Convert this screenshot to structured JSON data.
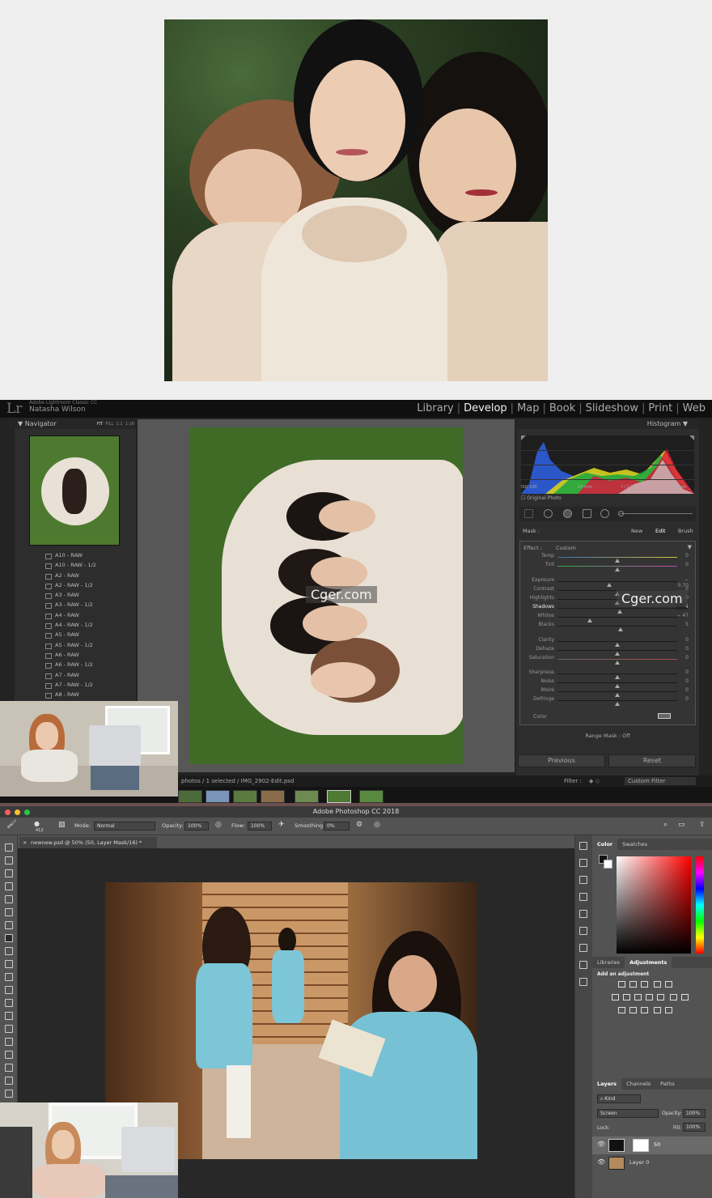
{
  "lightroom": {
    "app_name": "Adobe Lightroom Classic CC",
    "user": "Natasha Wilson",
    "modules": [
      "Library",
      "Develop",
      "Map",
      "Book",
      "Slideshow",
      "Print",
      "Web"
    ],
    "active_module": "Develop",
    "navigator": {
      "title": "Navigator",
      "zoom": [
        "FIT",
        "FILL",
        "1:1",
        "1:16"
      ]
    },
    "folders": [
      "A10 - RAW",
      "A10 - RAW - 1/2",
      "A2 - RAW",
      "A2 - RAW - 1/2",
      "A3 - RAW",
      "A3 - RAW - 1/2",
      "A4 - RAW",
      "A4 - RAW - 1/2",
      "A5 - RAW",
      "A5 - RAW - 1/2",
      "A6 - RAW",
      "A6 - RAW - 1/2",
      "A7 - RAW",
      "A7 - RAW - 1/2",
      "A8 - RAW"
    ],
    "histogram": {
      "title": "Histogram",
      "iso": "ISO 100",
      "focal": "24 mm",
      "aperture": "f / 2.8",
      "shutter": "1/320 sec",
      "original_photo": "Original Photo"
    },
    "mask": {
      "label": "Mask :",
      "options": [
        "New",
        "Edit",
        "Brush"
      ],
      "active": "Edit"
    },
    "effect": {
      "label": "Effect :",
      "preset": "Custom",
      "sliders": [
        {
          "label": "Temp",
          "value": "0",
          "pos": 0.5
        },
        {
          "label": "Tint",
          "value": "0",
          "pos": 0.5
        },
        {
          "label": "Exposure",
          "value": "− 0.70",
          "pos": 0.43
        },
        {
          "label": "Contrast",
          "value": "0",
          "pos": 0.5
        },
        {
          "label": "Highlights",
          "value": "0",
          "pos": 0.5
        },
        {
          "label": "Shadows",
          "value": "4",
          "pos": 0.52
        },
        {
          "label": "Whites",
          "value": "− 47",
          "pos": 0.27
        },
        {
          "label": "Blacks",
          "value": "5",
          "pos": 0.53
        },
        {
          "label": "Clarity",
          "value": "0",
          "pos": 0.5
        },
        {
          "label": "Dehaze",
          "value": "0",
          "pos": 0.5
        },
        {
          "label": "Saturation",
          "value": "0",
          "pos": 0.5
        },
        {
          "label": "Sharpness",
          "value": "0",
          "pos": 0.5
        },
        {
          "label": "Noise",
          "value": "0",
          "pos": 0.5
        },
        {
          "label": "Moiré",
          "value": "0",
          "pos": 0.5
        },
        {
          "label": "Defringe",
          "value": "0",
          "pos": 0.5
        }
      ],
      "color_label": "Color"
    },
    "range_mask": "Range Mask : Off",
    "buttons": {
      "previous": "Previous",
      "reset": "Reset"
    },
    "filmstrip": {
      "info": "photos / 1 selected / IMG_2902-Edit.psd",
      "filter_label": "Filter :",
      "filter_value": "Custom Filter"
    }
  },
  "watermark": "Cger.com",
  "photoshop": {
    "title": "Adobe Photoshop CC 2018",
    "brush_size": "412",
    "mode_label": "Mode:",
    "mode_value": "Normal",
    "opacity_label": "Opacity:",
    "opacity_value": "100%",
    "flow_label": "Flow:",
    "flow_value": "100%",
    "smoothing_label": "Smoothing:",
    "smoothing_value": "0%",
    "doc_tab": "newnew.psd @ 50% (50, Layer Mask/16) *",
    "color_tabs": [
      "Color",
      "Swatches"
    ],
    "adj_tabs": [
      "Libraries",
      "Adjustments"
    ],
    "add_adjustment": "Add an adjustment",
    "layer_tabs": [
      "Layers",
      "Channels",
      "Paths"
    ],
    "kind_label": "Kind",
    "blend_mode": "Screen",
    "layer_opacity_label": "Opacity:",
    "layer_opacity_value": "100%",
    "lock_label": "Lock:",
    "fill_label": "Fill:",
    "fill_value": "100%",
    "layers": [
      {
        "name": "50"
      },
      {
        "name": "Layer 0"
      }
    ]
  },
  "colors": {
    "lr_bg": "#232323",
    "ps_bg": "#535353",
    "accent_red": "#e0143c"
  }
}
